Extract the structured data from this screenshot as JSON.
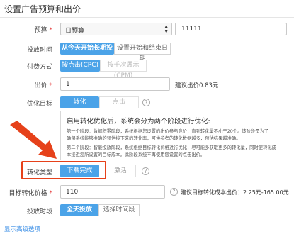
{
  "page": {
    "title": "设置广告预算和出价",
    "advanced_link": "显示高级选项"
  },
  "budget": {
    "label": "预算",
    "required_mark": "*",
    "type_value": "日预算",
    "amount": "11111"
  },
  "schedule": {
    "label": "投放时间",
    "option_active": "从今天开始长期投放",
    "option_other": "设置开始和结束日期"
  },
  "pay_mode": {
    "label": "付费方式",
    "option_active": "按点击(CPC)",
    "option_disabled": "按千次展示(CPM)"
  },
  "bid": {
    "label": "出价",
    "required_mark": "*",
    "value": "1",
    "suggestion": "建议出价0.83元"
  },
  "opt_goal": {
    "label": "优化目标",
    "option_active": "转化",
    "option_other": "点击",
    "help_icon": "?"
  },
  "tip": {
    "heading": "启用转化优化后，系统会分为两个阶段进行优化:",
    "p1": [
      "第一个阶段：数据积累阶段，系统根据您设置的出价参与竞价，直到转化量不小于20个。该阶段是为了",
      "确保系统能够准确的预估接下来的转化率，可供参考的转化数据越多，预估结果越准确。"
    ],
    "p2": [
      "第二个阶段：智能投放阶段，系统根据目标转化价格进行优化，尽可能多获取更多的转化量，同时使转化成",
      "本接近您所设置的目标成本。此阶段系统不再使用您设置的点击出价。"
    ]
  },
  "conv_type": {
    "label": "转化类型",
    "option_active": "下载完成",
    "option_other": "激活",
    "help_icon": "?"
  },
  "target_price": {
    "label": "目标转化价格",
    "required_mark": "*",
    "value": "110",
    "help_icon": "?",
    "suggestion": "建议目标转化成本出价：2.25元-165.00元"
  },
  "delivery": {
    "label": "投放时段",
    "option_active": "全天投放",
    "option_other": "选择时间段"
  },
  "colors": {
    "accent": "#4ba3e8",
    "highlight": "#e6411a",
    "link": "#3a8ee6",
    "required": "#e64545"
  }
}
